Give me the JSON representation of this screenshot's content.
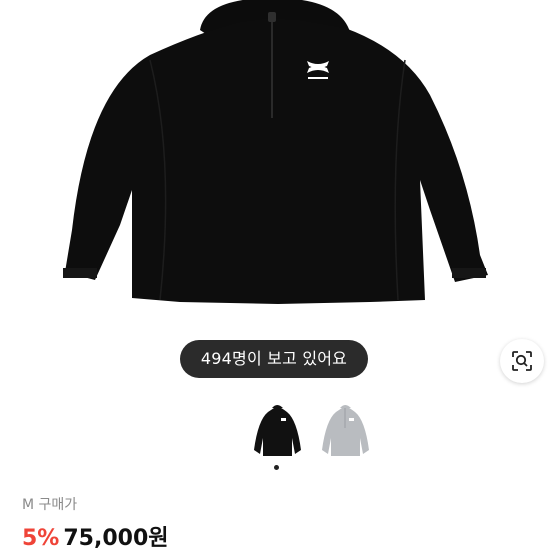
{
  "product": {
    "viewers_text": "494명이 보고 있어요",
    "thumbnails": [
      {
        "name": "black-jacket",
        "color": "#111111",
        "selected": true
      },
      {
        "name": "gray-jacket",
        "color": "#b9bcc0",
        "selected": false
      }
    ],
    "size_label": "M 구매가",
    "discount": "5%",
    "price": "75,000원"
  },
  "colors": {
    "discount": "#ef4438",
    "pill_background": "#2b2b2b"
  },
  "icons": [
    "lens-search-icon",
    "brand-logo-icon"
  ]
}
